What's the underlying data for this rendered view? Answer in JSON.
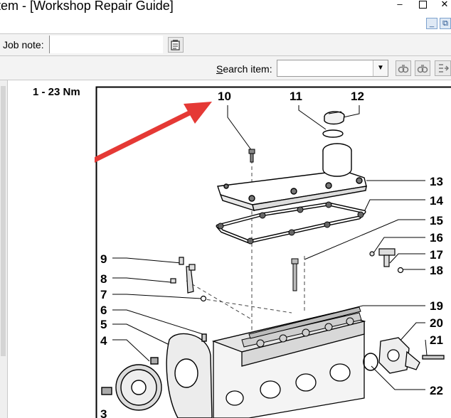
{
  "window": {
    "title": "tem - [Workshop Repair Guide]"
  },
  "toolbar": {
    "job_note_label": "Job note:",
    "search_label_first": "S",
    "search_label_rest": "earch item:",
    "search_value": ""
  },
  "content": {
    "torque_spec": "1 - 23 Nm"
  },
  "diagram": {
    "callouts": [
      "10",
      "11",
      "12",
      "13",
      "14",
      "15",
      "16",
      "17",
      "18",
      "19",
      "20",
      "21",
      "22",
      "9",
      "8",
      "7",
      "6",
      "5",
      "4",
      "3"
    ],
    "annotation_color": "#e53935"
  }
}
